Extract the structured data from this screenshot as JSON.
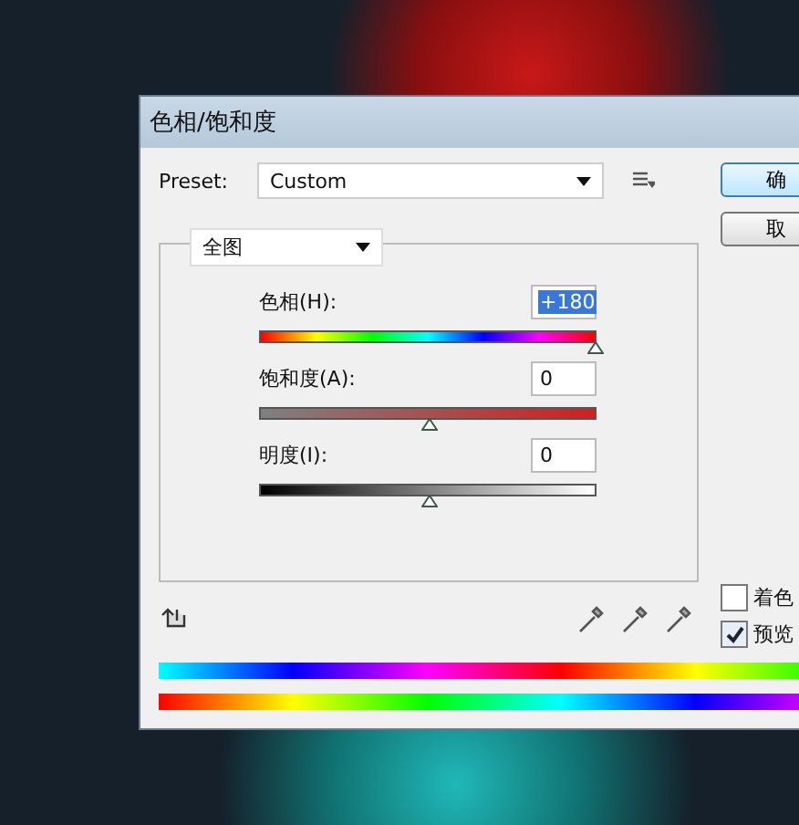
{
  "window": {
    "title": "色相/饱和度"
  },
  "preset": {
    "label": "Preset:",
    "value": "Custom"
  },
  "channel": {
    "value": "全图"
  },
  "adjustments": [
    {
      "label": "色相(H):",
      "value": "+180",
      "selected": true,
      "level": 1.0,
      "kind": "hue"
    },
    {
      "label": "饱和度(A):",
      "value": "0",
      "selected": false,
      "level": 0.5,
      "kind": "saturation"
    },
    {
      "label": "明度(I):",
      "value": "0",
      "selected": false,
      "level": 0.5,
      "kind": "lightness"
    }
  ],
  "buttons": [
    {
      "label": "确"
    },
    {
      "label": "取"
    }
  ],
  "options": [
    {
      "label": "着色",
      "checked": false
    },
    {
      "label": "预览",
      "checked": true
    }
  ]
}
